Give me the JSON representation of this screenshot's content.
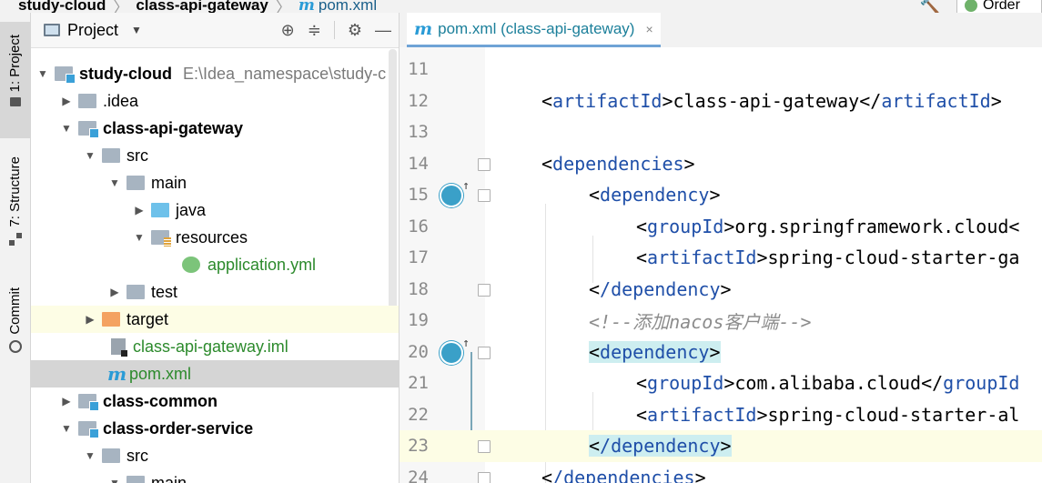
{
  "breadcrumb": {
    "items": [
      "study-cloud",
      "class-api-gateway",
      "pom.xml"
    ],
    "file_icon": "m"
  },
  "toolbar": {
    "run_config_label": "Order"
  },
  "stripe": {
    "project_label": "1: Project",
    "structure_label": "7: Structure",
    "commit_label": "Commit"
  },
  "project_panel": {
    "title": "Project",
    "tree": [
      {
        "label": "study-cloud",
        "extra": "E:\\Idea_namespace\\study-c",
        "bold": true
      },
      {
        "label": ".idea"
      },
      {
        "label": "class-api-gateway",
        "bold": true
      },
      {
        "label": "src"
      },
      {
        "label": "main"
      },
      {
        "label": "java"
      },
      {
        "label": "resources"
      },
      {
        "label": "application.yml"
      },
      {
        "label": "test"
      },
      {
        "label": "target"
      },
      {
        "label": "class-api-gateway.iml"
      },
      {
        "label": "pom.xml"
      },
      {
        "label": "class-common",
        "bold": true
      },
      {
        "label": "class-order-service",
        "bold": true
      },
      {
        "label": "src"
      },
      {
        "label": "main"
      }
    ]
  },
  "editor": {
    "tab": {
      "label": "pom.xml (class-api-gateway)",
      "close": "×"
    },
    "lines": [
      {
        "num": "11"
      },
      {
        "num": "12"
      },
      {
        "num": "13"
      },
      {
        "num": "14"
      },
      {
        "num": "15"
      },
      {
        "num": "16"
      },
      {
        "num": "17"
      },
      {
        "num": "18"
      },
      {
        "num": "19"
      },
      {
        "num": "20"
      },
      {
        "num": "21"
      },
      {
        "num": "22"
      },
      {
        "num": "23"
      },
      {
        "num": "24"
      }
    ],
    "code": {
      "l12_tag": "artifactId",
      "l12_val": "class-api-gateway",
      "l14_tag": "dependencies",
      "l15_tag": "dependency",
      "l16_tag": "groupId",
      "l16_val": "org.springframework.cloud<",
      "l17_tag": "artifactId",
      "l17_val": "spring-cloud-starter-ga",
      "l18_tag": "/dependency",
      "l19_comment": "<!--添加nacos客户端-->",
      "l20_tag": "dependency",
      "l21_tag": "groupId",
      "l21_val": "com.alibaba.cloud</",
      "l21_tail": "groupId",
      "l22_tag": "artifactId",
      "l22_val": "spring-cloud-starter-al",
      "l23_tag": "/dependency",
      "l24_tag": "/dependencies"
    }
  }
}
